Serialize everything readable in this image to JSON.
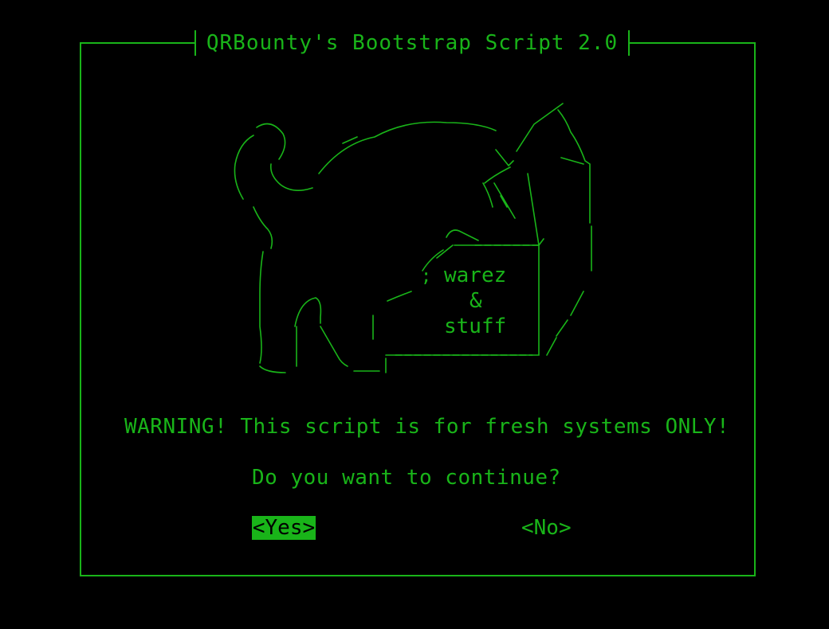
{
  "dialog": {
    "title": "QRBounty's Bootstrap Script 2.0",
    "warning": "WARNING! This script is for fresh systems ONLY!",
    "question": "Do you want to continue?",
    "yes_label": "<Yes>",
    "no_label": "<No>"
  },
  "art": {
    "box_line1": "warez",
    "box_line2": "&",
    "box_line3": "stuff"
  },
  "colors": {
    "accent": "#19b419",
    "background": "#000000",
    "selected_text": "#000000"
  }
}
